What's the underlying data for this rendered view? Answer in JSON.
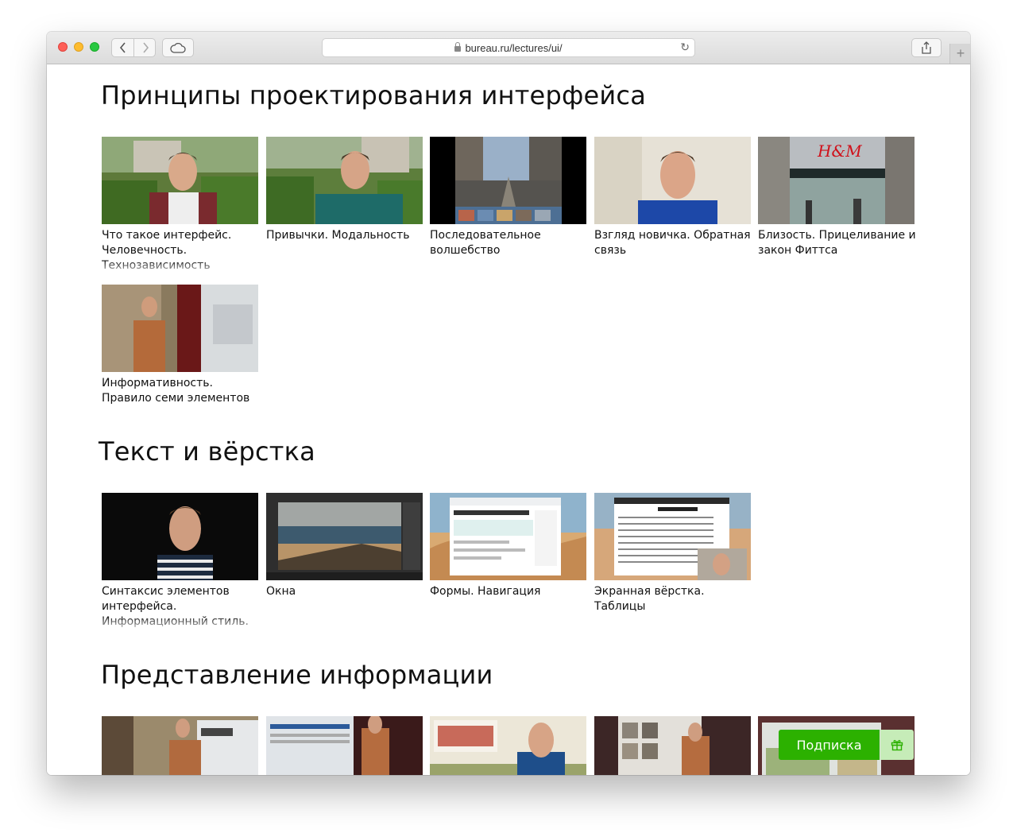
{
  "browser": {
    "url": "bureau.ru/lectures/ui/"
  },
  "sections": [
    {
      "title": "Принципы проектирования интерфейса",
      "cards": [
        {
          "caption": "Что такое интерфейс. Человечность. Технозависимость"
        },
        {
          "caption": "Привычки. Модальность"
        },
        {
          "caption": "Последовательное волшебство"
        },
        {
          "caption": "Взгляд новичка. Обратная связь"
        },
        {
          "caption": "Близость. Прицеливание и закон Фиттса"
        },
        {
          "caption": "Информативность. Правило семи элементов"
        }
      ]
    },
    {
      "title": "Текст и вёрстка",
      "cards": [
        {
          "caption": "Синтаксис элементов интерфейса. Информационный стиль."
        },
        {
          "caption": "Окна"
        },
        {
          "caption": "Формы. Навигация"
        },
        {
          "caption": "Экранная вёрстка. Таблицы"
        }
      ]
    },
    {
      "title": "Представление информации",
      "cards": [
        {
          "caption": ""
        },
        {
          "caption": ""
        },
        {
          "caption": ""
        },
        {
          "caption": ""
        },
        {
          "caption": ""
        }
      ]
    }
  ],
  "subscribe": {
    "label": "Подписка",
    "icon": "gift-icon"
  },
  "colors": {
    "subscribe_green": "#2cb100",
    "gift_bg": "#c6ecb8"
  }
}
